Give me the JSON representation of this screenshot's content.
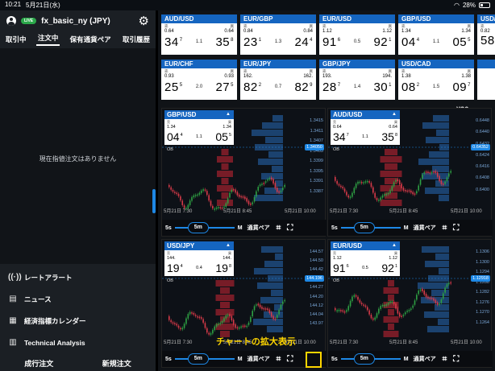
{
  "status": {
    "time": "10:21",
    "date": "5月21日(水)",
    "battery": "28%"
  },
  "account": {
    "live": "LIVE",
    "name": "fx_basic_ny (JPY)"
  },
  "left_tabs": [
    "取引中",
    "注文中",
    "保有通貨ペア",
    "取引履歴"
  ],
  "orders_empty": "現在指値注文はありません",
  "menu": [
    {
      "icon": "📶",
      "label": "レートアラート"
    },
    {
      "icon": "📰",
      "label": "ニュース"
    },
    {
      "icon": "📅",
      "label": "経済指標カレンダー"
    },
    {
      "icon": "📊",
      "label": "Technical Analysis"
    }
  ],
  "bottom": {
    "left": "成行注文",
    "right": "新規注文"
  },
  "tile_labels": {
    "sell": "売",
    "buy": "買"
  },
  "tiles": [
    {
      "pair": "AUD/USD",
      "sell_pre": "0.64",
      "sell_big": "34",
      "sell_sup": "7",
      "spread": "1.1",
      "buy_pre": "0.64",
      "buy_big": "35",
      "buy_sup": "8"
    },
    {
      "pair": "EUR/GBP",
      "sell_pre": "0.84",
      "sell_big": "23",
      "sell_sup": "1",
      "spread": "1.3",
      "buy_pre": "0.84",
      "buy_big": "24",
      "buy_sup": "4"
    },
    {
      "pair": "EUR/USD",
      "sell_pre": "1.12",
      "sell_big": "91",
      "sell_sup": "6",
      "spread": "0.5",
      "buy_pre": "1.12",
      "buy_big": "92",
      "buy_sup": "1"
    },
    {
      "pair": "GBP/USD",
      "sell_pre": "1.34",
      "sell_big": "04",
      "sell_sup": "4",
      "spread": "1.1",
      "buy_pre": "1.34",
      "buy_big": "05",
      "buy_sup": "5"
    },
    {
      "pair": "EUR/CHF",
      "sell_pre": "0.93",
      "sell_big": "25",
      "sell_sup": "5",
      "spread": "2.0",
      "buy_pre": "0.93",
      "buy_big": "27",
      "buy_sup": "5"
    },
    {
      "pair": "EUR/JPY",
      "sell_pre": "162.",
      "sell_big": "82",
      "sell_sup": "2",
      "spread": "0.7",
      "buy_pre": "162.",
      "buy_big": "82",
      "buy_sup": "9"
    },
    {
      "pair": "GBP/JPY",
      "sell_pre": "193.",
      "sell_big": "28",
      "sell_sup": "7",
      "spread": "1.4",
      "buy_pre": "194.",
      "buy_big": "30",
      "buy_sup": "1"
    },
    {
      "pair": "USD/CAD",
      "sell_pre": "1.38",
      "sell_big": "08",
      "sell_sup": "2",
      "spread": "1.5",
      "buy_pre": "1.38",
      "buy_big": "09",
      "buy_sup": "7"
    }
  ],
  "extra_tiles": [
    {
      "pair": "USD/C",
      "sell_pre": "0.82",
      "sell_big": "58",
      "sell_sup": ""
    },
    {
      "pair": "",
      "sell_pre": "",
      "sell_big": "",
      "sell_sup": ""
    }
  ],
  "charts_header": "¥$€",
  "charts": [
    {
      "pair": "GBP/USD",
      "sell_pre": "1.34",
      "sell_big": "04",
      "sell_sup": "4",
      "spread": "1.1",
      "buy_pre": "1.34",
      "buy_big": "05",
      "buy_sup": "5",
      "ob": "OB",
      "axis": [
        "1.3415",
        "1.3411",
        "1.3407",
        "1.3403",
        "1.3399",
        "1.3395",
        "1.3391",
        "1.3387"
      ],
      "current": "1.34050",
      "times": [
        "5月21日 7:30",
        "5月21日 8:45",
        "5月21日 10:00"
      ],
      "interval": "5m",
      "min": "5s",
      "max": "M",
      "pair_btn": "通貨ペア"
    },
    {
      "pair": "AUD/USD",
      "sell_pre": "0.64",
      "sell_big": "34",
      "sell_sup": "7",
      "spread": "1.1",
      "buy_pre": "0.64",
      "buy_big": "35",
      "buy_sup": "8",
      "ob": "OB",
      "axis": [
        "0.6448",
        "0.6440",
        "0.6432",
        "0.6424",
        "0.6416",
        "0.6408",
        "0.6400"
      ],
      "current": "0.64352",
      "times": [
        "5月21日 7:30",
        "5月21日 8:45",
        "5月21日 10:00"
      ],
      "interval": "5m",
      "min": "5s",
      "max": "M",
      "pair_btn": "通貨ペア"
    },
    {
      "pair": "USD/JPY",
      "sell_pre": "144.",
      "sell_big": "19",
      "sell_sup": "4",
      "spread": "0.4",
      "buy_pre": "144.",
      "buy_big": "19",
      "buy_sup": "8",
      "ob": "OB",
      "axis": [
        "144.57",
        "144.50",
        "144.42",
        "144.35",
        "144.27",
        "144.20",
        "144.12",
        "144.04",
        "143.97"
      ],
      "current": "144.196",
      "times": [
        "5月21日 7:30",
        "5月21日 8:45",
        "5月21日 10:00"
      ],
      "interval": "5m",
      "min": "5s",
      "max": "M",
      "pair_btn": "通貨ペア"
    },
    {
      "pair": "EUR/USD",
      "sell_pre": "1.12",
      "sell_big": "91",
      "sell_sup": "6",
      "spread": "0.5",
      "buy_pre": "1.12",
      "buy_big": "92",
      "buy_sup": "1",
      "ob": "OB",
      "axis": [
        "1.1306",
        "1.1300",
        "1.1294",
        "1.1288",
        "1.1282",
        "1.1276",
        "1.1270",
        "1.1264"
      ],
      "current": "1.12918",
      "times": [
        "5月21日 7:30",
        "5月21日 8:45",
        "5月21日 10:00"
      ],
      "interval": "5m",
      "min": "5s",
      "max": "M",
      "pair_btn": "通貨ペア"
    }
  ],
  "annotation": "チャートの拡大表示"
}
